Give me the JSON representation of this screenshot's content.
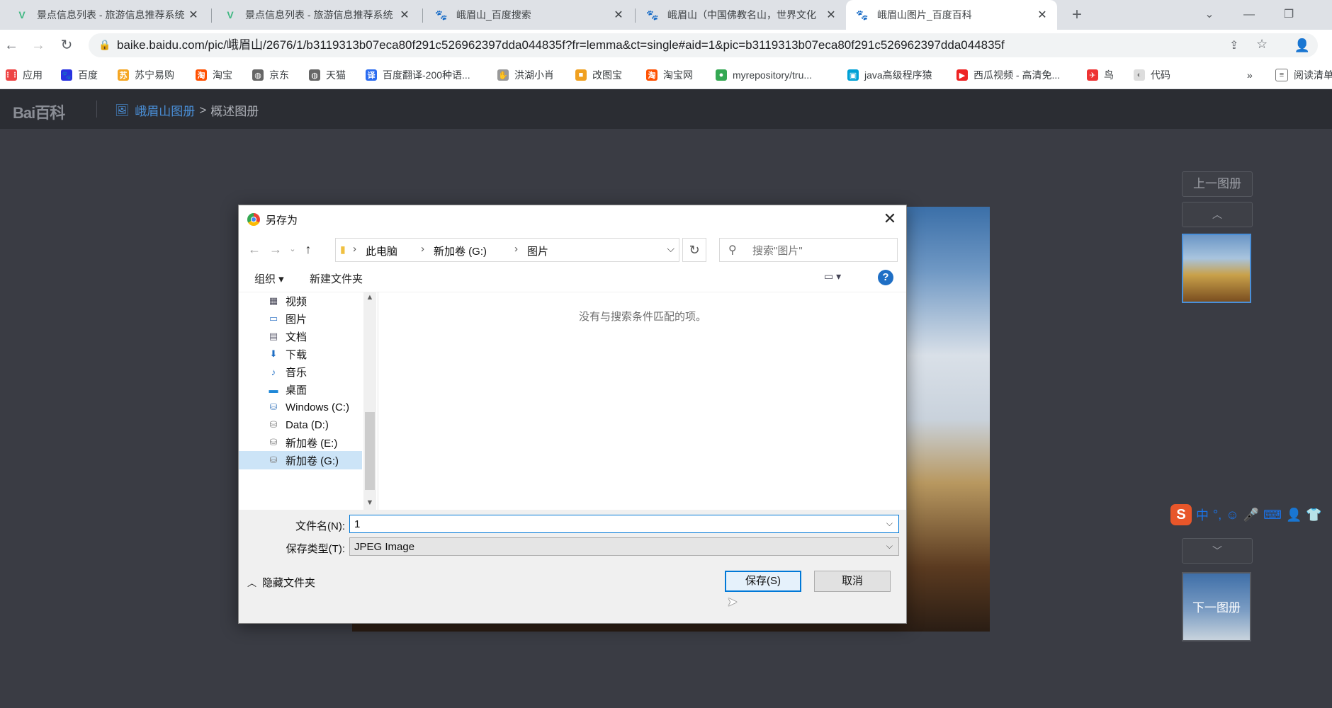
{
  "browser": {
    "tabs": [
      {
        "title": "景点信息列表 - 旅游信息推荐系统",
        "icon": "vue-icon"
      },
      {
        "title": "景点信息列表 - 旅游信息推荐系统",
        "icon": "vue-icon"
      },
      {
        "title": "峨眉山_百度搜索",
        "icon": "baidu-paw-icon"
      },
      {
        "title": "峨眉山（中国佛教名山，世界文化",
        "icon": "baidu-paw-icon"
      },
      {
        "title": "峨眉山图片_百度百科",
        "icon": "baidu-paw-icon",
        "active": true
      }
    ],
    "url": "baike.baidu.com/pic/峨眉山/2676/1/b3119313b07eca80f291c526962397dda044835f?fr=lemma&ct=single#aid=1&pic=b3119313b07eca80f291c526962397dda044835f",
    "bookmarks": [
      "应用",
      "百度",
      "苏宁易购",
      "淘宝",
      "京东",
      "天猫",
      "百度翻译-200种语...",
      "洪湖小肖",
      "改图宝",
      "淘宝网",
      "myrepository/tru...",
      "java高级程序猿",
      "西瓜视频 - 高清免...",
      "鸟",
      "代码"
    ],
    "reading_list": "阅读清单"
  },
  "baike": {
    "logo": "Bai百科",
    "breadcrumb_album": "峨眉山图册",
    "breadcrumb_sep": ">",
    "breadcrumb_current": "概述图册",
    "prev_album": "上一图册",
    "next_album": "下一图册"
  },
  "dialog": {
    "title": "另存为",
    "path": [
      "此电脑",
      "新加卷 (G:)",
      "图片"
    ],
    "search_placeholder": "搜索\"图片\"",
    "organize": "组织 ▾",
    "new_folder": "新建文件夹",
    "nav_items": [
      "视频",
      "图片",
      "文档",
      "下载",
      "音乐",
      "桌面",
      "Windows (C:)",
      "Data (D:)",
      "新加卷 (E:)",
      "新加卷 (G:)"
    ],
    "empty_message": "没有与搜索条件匹配的项。",
    "filename_label": "文件名(N):",
    "filename_value": "1",
    "filetype_label": "保存类型(T):",
    "filetype_value": "JPEG Image",
    "hide_folders": "隐藏文件夹",
    "save_button": "保存(S)",
    "cancel_button": "取消"
  },
  "ime": {
    "logo": "S",
    "mode": "中"
  },
  "colors": {
    "accent": "#0078d7",
    "baike_link": "#4a90d9",
    "selected_nav": "#cce4f7"
  }
}
